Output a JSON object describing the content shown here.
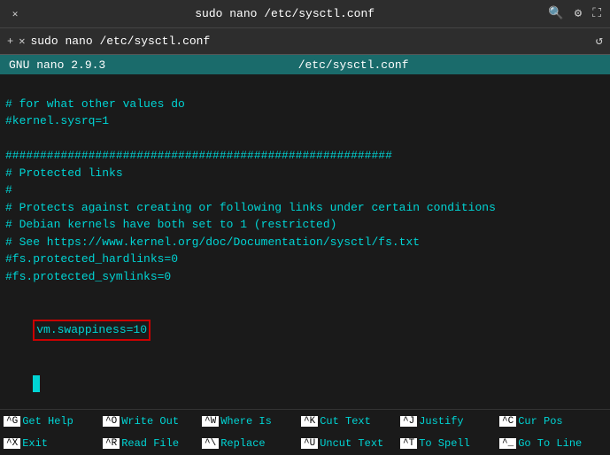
{
  "titlebar": {
    "close_label": "✕",
    "title": "sudo nano /etc/sysctl.conf",
    "search_icon": "🔍",
    "settings_icon": "⚙",
    "expand_icon": "⛶"
  },
  "tabbar": {
    "new_tab_icon": "+",
    "close_tab_icon": "✕",
    "tab_title": "sudo nano /etc/sysctl.conf",
    "reload_icon": "↺"
  },
  "nano_header": {
    "left": "GNU nano 2.9.3",
    "center": "/etc/sysctl.conf"
  },
  "editor": {
    "lines": [
      "",
      "# for what other values do",
      "#kernel.sysrq=1",
      "",
      "########################################################",
      "# Protected links",
      "#",
      "# Protects against creating or following links under certain conditions",
      "# Debian kernels have both set to 1 (restricted)",
      "# See https://www.kernel.org/doc/Documentation/sysctl/fs.txt",
      "#fs.protected_hardlinks=0",
      "#fs.protected_symlinks=0",
      ""
    ],
    "highlight_line": "vm.swappiness=10",
    "cursor_line": ""
  },
  "footer": {
    "rows": [
      [
        {
          "key": "^G",
          "label": "Get Help"
        },
        {
          "key": "^O",
          "label": "Write Out"
        },
        {
          "key": "^W",
          "label": "Where Is"
        },
        {
          "key": "^K",
          "label": "Cut Text"
        },
        {
          "key": "^J",
          "label": "Justify"
        },
        {
          "key": "^C",
          "label": "Cur Pos"
        }
      ],
      [
        {
          "key": "^X",
          "label": "Exit"
        },
        {
          "key": "^R",
          "label": "Read File"
        },
        {
          "key": "^\\",
          "label": "Replace"
        },
        {
          "key": "^U",
          "label": "Uncut Text"
        },
        {
          "key": "^T",
          "label": "To Spell"
        },
        {
          "key": "^_",
          "label": "Go To Line"
        }
      ]
    ]
  }
}
